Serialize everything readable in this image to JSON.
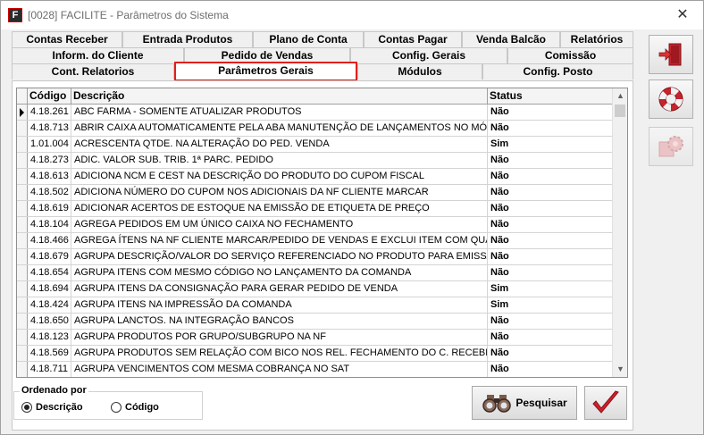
{
  "window": {
    "title": "[0028] FACILITE - Parâmetros do Sistema",
    "app_icon_letter": "F",
    "close_glyph": "✕"
  },
  "tabs": {
    "row1": [
      "Contas Receber",
      "Entrada Produtos",
      "Plano de Conta",
      "Contas Pagar",
      "Venda Balcão",
      "Relatórios"
    ],
    "row2": [
      "Inform. do Cliente",
      "Pedido de Vendas",
      "Config. Gerais",
      "Comissão"
    ],
    "row3": [
      "Cont. Relatorios",
      "Parâmetros Gerais",
      "Módulos",
      "Config. Posto"
    ],
    "active": "Parâmetros Gerais"
  },
  "grid": {
    "headers": [
      "Código",
      "Descrição",
      "Status"
    ],
    "rows": [
      {
        "code": "4.18.261",
        "desc": "ABC FARMA - SOMENTE ATUALIZAR PRODUTOS",
        "status": "Não"
      },
      {
        "code": "4.18.713",
        "desc": "ABRIR CAIXA AUTOMATICAMENTE PELA ABA MANUTENÇÃO DE LANÇAMENTOS NO MÓDULO",
        "status": "Não"
      },
      {
        "code": "1.01.004",
        "desc": "ACRESCENTA QTDE. NA ALTERAÇÃO DO PED. VENDA",
        "status": "Sim"
      },
      {
        "code": "4.18.273",
        "desc": "ADIC. VALOR SUB. TRIB. 1ª PARC. PEDIDO",
        "status": "Não"
      },
      {
        "code": "4.18.613",
        "desc": "ADICIONA NCM E CEST NA DESCRIÇÃO DO PRODUTO DO CUPOM FISCAL",
        "status": "Não"
      },
      {
        "code": "4.18.502",
        "desc": "ADICIONA NÚMERO DO CUPOM NOS ADICIONAIS DA NF CLIENTE MARCAR",
        "status": "Não"
      },
      {
        "code": "4.18.619",
        "desc": "ADICIONAR ACERTOS DE ESTOQUE NA EMISSÃO DE ETIQUETA DE PREÇO",
        "status": "Não"
      },
      {
        "code": "4.18.104",
        "desc": "AGREGA PEDIDOS EM UM ÚNICO CAIXA NO FECHAMENTO",
        "status": "Não"
      },
      {
        "code": "4.18.466",
        "desc": "AGREGA ÍTENS NA NF CLIENTE MARCAR/PEDIDO DE VENDAS E EXCLUI ITEM COM QUANTIDADE",
        "status": "Não"
      },
      {
        "code": "4.18.679",
        "desc": "AGRUPA DESCRIÇÃO/VALOR DO SERVIÇO REFERENCIADO NO PRODUTO PARA EMISSÃO",
        "status": "Não"
      },
      {
        "code": "4.18.654",
        "desc": "AGRUPA ITENS COM MESMO CÓDIGO NO LANÇAMENTO DA COMANDA",
        "status": "Não"
      },
      {
        "code": "4.18.694",
        "desc": "AGRUPA ITENS DA CONSIGNAÇÃO PARA GERAR PEDIDO DE VENDA",
        "status": "Sim"
      },
      {
        "code": "4.18.424",
        "desc": "AGRUPA ITENS NA IMPRESSÃO DA COMANDA",
        "status": "Sim"
      },
      {
        "code": "4.18.650",
        "desc": "AGRUPA LANCTOS. NA INTEGRAÇÃO BANCOS",
        "status": "Não"
      },
      {
        "code": "4.18.123",
        "desc": "AGRUPA PRODUTOS POR GRUPO/SUBGRUPO NA NF",
        "status": "Não"
      },
      {
        "code": "4.18.569",
        "desc": "AGRUPA PRODUTOS SEM RELAÇÃO COM BICO NOS REL. FECHAMENTO DO C. RECEBER",
        "status": "Não"
      },
      {
        "code": "4.18.711",
        "desc": "AGRUPA VENCIMENTOS COM MESMA COBRANÇA NO SAT",
        "status": "Não"
      }
    ]
  },
  "order": {
    "label": "Ordenado por",
    "options": [
      "Descrição",
      "Código"
    ],
    "selected": "Descrição"
  },
  "buttons": {
    "search": "Pesquisar"
  },
  "colors": {
    "active_tab_border": "#e0201a",
    "confirm_check": "#d0202a",
    "exit_icon": "#c8242b"
  },
  "icons": {
    "exit": "exit-door-icon",
    "help": "lifebuoy-icon",
    "settings": "gear-icon",
    "search": "binoculars-icon",
    "confirm": "checkmark-icon"
  }
}
